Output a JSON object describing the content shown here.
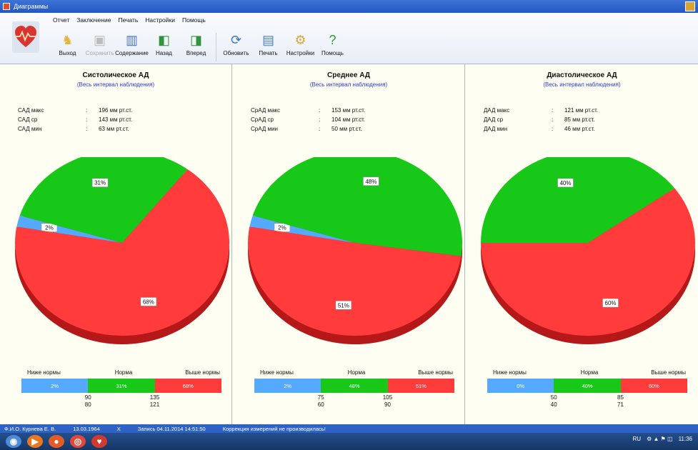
{
  "window": {
    "title": "Диаграммы"
  },
  "menu": [
    "Отчет",
    "Заключение",
    "Печать",
    "Настройки",
    "Помощь"
  ],
  "toolbar": [
    {
      "label": "Выход",
      "icon": "exit-icon",
      "disabled": false
    },
    {
      "label": "Сохранить",
      "icon": "save-icon",
      "disabled": true
    },
    {
      "label": "Содержание",
      "icon": "book-icon",
      "disabled": false
    },
    {
      "label": "Назад",
      "icon": "back-icon",
      "disabled": false
    },
    {
      "label": "Вперед",
      "icon": "forward-icon",
      "disabled": false
    },
    {
      "label": "Обновить",
      "icon": "refresh-icon",
      "disabled": false
    },
    {
      "label": "Печать",
      "icon": "printer-icon",
      "disabled": false
    },
    {
      "label": "Настройки",
      "icon": "settings-icon",
      "disabled": false
    },
    {
      "label": "Помощь",
      "icon": "help-icon",
      "disabled": false
    }
  ],
  "colors": {
    "below": "#55aaff",
    "normal": "#18c818",
    "above": "#ff3b3b"
  },
  "legend_labels": [
    "Ниже нормы",
    "Норма",
    "Выше нормы"
  ],
  "panels": [
    {
      "title": "Систолическое АД",
      "subtitle": "(Весь интервал наблюдения)",
      "stats": [
        {
          "name": "САД макс",
          "value": "196 мм рт.ст."
        },
        {
          "name": "САД ср",
          "value": "143 мм рт.ст."
        },
        {
          "name": "САД мин",
          "value": "63 мм рт.ст."
        }
      ],
      "chart": {
        "type": "pie",
        "slices": [
          {
            "name": "Ниже нормы",
            "value": 2,
            "label": "2%"
          },
          {
            "name": "Норма",
            "value": 31,
            "label": "31%"
          },
          {
            "name": "Выше нормы",
            "value": 68,
            "label": "68%"
          }
        ]
      },
      "bar_labels": [
        "2%",
        "31%",
        "68%"
      ],
      "thresholds": {
        "low": [
          "90",
          "80"
        ],
        "high": [
          "135",
          "121"
        ]
      }
    },
    {
      "title": "Среднее АД",
      "subtitle": "(Весь интервал наблюдения)",
      "stats": [
        {
          "name": "СрАД макс",
          "value": "153 мм рт.ст."
        },
        {
          "name": "СрАД ср",
          "value": "104 мм рт.ст."
        },
        {
          "name": "СрАД мин",
          "value": "50 мм рт.ст."
        }
      ],
      "chart": {
        "type": "pie",
        "slices": [
          {
            "name": "Ниже нормы",
            "value": 2,
            "label": "2%"
          },
          {
            "name": "Норма",
            "value": 48,
            "label": "48%"
          },
          {
            "name": "Выше нормы",
            "value": 51,
            "label": "51%"
          }
        ]
      },
      "bar_labels": [
        "2%",
        "48%",
        "51%"
      ],
      "thresholds": {
        "low": [
          "75",
          "60"
        ],
        "high": [
          "105",
          "90"
        ]
      }
    },
    {
      "title": "Диастолическое АД",
      "subtitle": "(Весь интервал наблюдения)",
      "stats": [
        {
          "name": "ДАД макс",
          "value": "121 мм рт.ст."
        },
        {
          "name": "ДАД ср",
          "value": "85 мм рт.ст."
        },
        {
          "name": "ДАД мин",
          "value": "46 мм рт.ст."
        }
      ],
      "chart": {
        "type": "pie",
        "slices": [
          {
            "name": "Ниже нормы",
            "value": 0,
            "label": ""
          },
          {
            "name": "Норма",
            "value": 40,
            "label": "40%"
          },
          {
            "name": "Выше нормы",
            "value": 60,
            "label": "60%"
          }
        ]
      },
      "bar_labels": [
        "0%",
        "40%",
        "60%"
      ],
      "thresholds": {
        "low": [
          "50",
          "40"
        ],
        "high": [
          "85",
          "71"
        ]
      }
    }
  ],
  "chart_data": [
    {
      "type": "pie",
      "title": "Систолическое АД",
      "categories": [
        "Ниже нормы",
        "Норма",
        "Выше нормы"
      ],
      "values": [
        2,
        31,
        68
      ]
    },
    {
      "type": "pie",
      "title": "Среднее АД",
      "categories": [
        "Ниже нормы",
        "Норма",
        "Выше нормы"
      ],
      "values": [
        2,
        48,
        51
      ]
    },
    {
      "type": "pie",
      "title": "Диастолическое АД",
      "categories": [
        "Ниже нормы",
        "Норма",
        "Выше нормы"
      ],
      "values": [
        0,
        40,
        60
      ]
    }
  ],
  "status": {
    "patient": "Ф.И.О. Курнева Е. В.",
    "date": "13.03.1964",
    "mark": "X",
    "record": "Запись 04.11.2014 14:51:50",
    "note": "Коррекция измерений не производилась!"
  },
  "taskbar": {
    "lang": "RU",
    "time": "11:36"
  }
}
